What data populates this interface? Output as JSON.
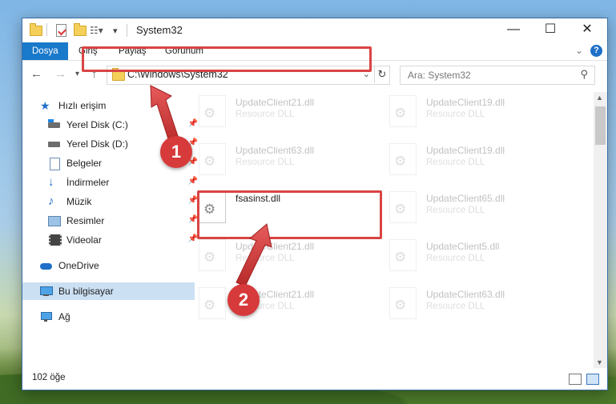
{
  "window": {
    "title": "System32",
    "controls": {
      "minimize": "—",
      "maximize": "☐",
      "close": "✕"
    }
  },
  "ribbon": {
    "tabs": [
      {
        "label": "Dosya",
        "active": true
      },
      {
        "label": "Giriş"
      },
      {
        "label": "Paylaş"
      },
      {
        "label": "Görünüm"
      }
    ],
    "help": "?"
  },
  "nav": {
    "address": "C:\\Windows\\System32",
    "search_placeholder": "Ara: System32"
  },
  "sidebar": {
    "items": [
      {
        "label": "Hızlı erişim",
        "icon": "star-icon"
      },
      {
        "label": "Yerel Disk (C:)",
        "icon": "drive-c-icon",
        "pinned": true
      },
      {
        "label": "Yerel Disk (D:)",
        "icon": "drive-d-icon",
        "pinned": true
      },
      {
        "label": "Belgeler",
        "icon": "documents-icon",
        "pinned": true
      },
      {
        "label": "İndirmeler",
        "icon": "download-icon",
        "pinned": true
      },
      {
        "label": "Müzik",
        "icon": "music-icon",
        "pinned": true
      },
      {
        "label": "Resimler",
        "icon": "pictures-icon",
        "pinned": true
      },
      {
        "label": "Videolar",
        "icon": "videos-icon",
        "pinned": true
      },
      {
        "label": "OneDrive",
        "icon": "cloud-icon"
      },
      {
        "label": "Bu bilgisayar",
        "icon": "computer-icon",
        "selected": true
      },
      {
        "label": "Ağ",
        "icon": "network-icon"
      }
    ]
  },
  "files": {
    "left": [
      {
        "name": "UpdateClient21.dll",
        "desc": "Resource DLL"
      },
      {
        "name": "UpdateClient63.dll",
        "desc": "Resource DLL"
      },
      {
        "name": "fsasinst.dll",
        "desc": ""
      },
      {
        "name": "UpdateClient21.dll",
        "desc": "Resource DLL"
      },
      {
        "name": "UpdateClient21.dll",
        "desc": "Resource DLL"
      }
    ],
    "right": [
      {
        "name": "UpdateClient19.dll",
        "desc": "Resource DLL"
      },
      {
        "name": "UpdateClient19.dll",
        "desc": "Resource DLL"
      },
      {
        "name": "UpdateClient65.dll",
        "desc": "Resource DLL"
      },
      {
        "name": "UpdateClient5.dll",
        "desc": "Resource DLL"
      },
      {
        "name": "UpdateClient63.dll",
        "desc": "Resource DLL"
      }
    ]
  },
  "status": {
    "count": "102 öğe"
  },
  "callouts": {
    "one": "1",
    "two": "2"
  },
  "colors": {
    "highlight": "#d94444",
    "accent": "#1979ca",
    "badge": "#d73a3a"
  }
}
